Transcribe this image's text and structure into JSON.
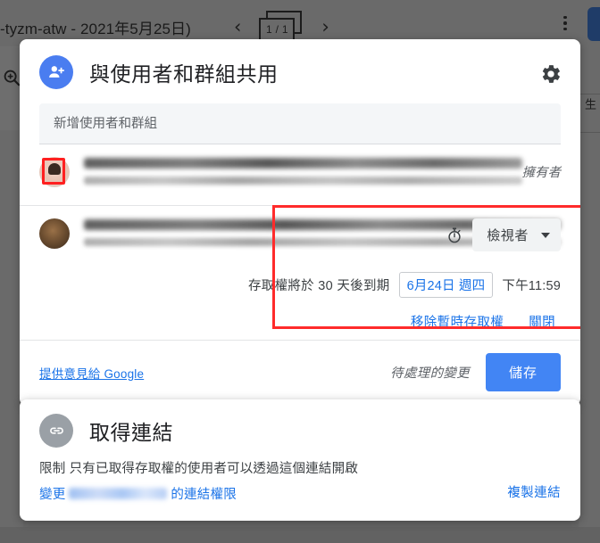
{
  "viewer": {
    "title": "-tyzm-atw - 2021年5月25日)",
    "page_indicator": "1 / 1",
    "prev_label": "‹",
    "next_label": "›",
    "right_edge_text": "生"
  },
  "share_dialog": {
    "title": "與使用者和群組共用",
    "header_icon": "person-add-icon",
    "settings_icon": "gear-icon",
    "add_input": {
      "placeholder": "新增使用者和群組",
      "value": ""
    },
    "people": [
      {
        "name": "",
        "email": "",
        "role": "擁有者",
        "avatar": "owner-avatar"
      },
      {
        "name": "",
        "email": "",
        "role": "檢視者",
        "avatar": "photo-avatar"
      }
    ],
    "expiry": {
      "timer_icon": "stopwatch-icon",
      "role_label": "檢視者",
      "description": "存取權將於 30 天後到期",
      "date": "6月24日 週四",
      "time": "下午11:59",
      "remove_label": "移除暫時存取權",
      "close_label": "關閉"
    },
    "footer": {
      "feedback_label": "提供意見給 Google",
      "pending_label": "待處理的變更",
      "save_label": "儲存"
    }
  },
  "link_section": {
    "title": "取得連結",
    "icon": "link-icon",
    "restriction": "限制 只有已取得存取權的使用者可以透過這個連結開啟",
    "change_prefix": "變更",
    "change_suffix": "的連結權限",
    "copy_label": "複製連結"
  },
  "colors": {
    "accent_blue": "#1a73e8",
    "save_blue": "#4285f4",
    "highlight_red": "#ff2b2b",
    "backdrop_gray": "#666666"
  }
}
